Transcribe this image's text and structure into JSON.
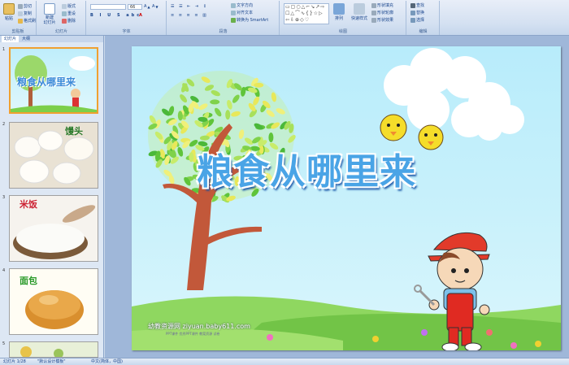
{
  "ribbon": {
    "groups": {
      "clipboard": "剪贴板",
      "slides": "幻灯片",
      "font": "字体",
      "paragraph": "段落",
      "drawing": "绘图",
      "editing": "编辑"
    },
    "paste": "粘贴",
    "cut": "剪切",
    "copy": "复制",
    "format_painter": "格式刷",
    "new_slide": "新建\n幻灯片",
    "layout": "版式",
    "reset": "重设",
    "delete": "删除",
    "font_size": "66",
    "text_direction": "文字方向",
    "align_text": "对齐文本",
    "convert_smartart": "转换为 SmartArt",
    "arrange": "排列",
    "quick_styles": "快速样式",
    "shape_fill": "形状填充",
    "shape_outline": "形状轮廓",
    "shape_effects": "形状效果",
    "find": "查找",
    "replace": "替换",
    "select": "选择"
  },
  "panel": {
    "tab_slides": "幻灯片",
    "tab_outline": "大纲",
    "thumbs": [
      {
        "num": "1",
        "caption": "粮食从哪里来"
      },
      {
        "num": "2",
        "caption": "馒头"
      },
      {
        "num": "3",
        "caption": "米饭"
      },
      {
        "num": "4",
        "caption": "面包"
      },
      {
        "num": "5",
        "caption": ""
      }
    ]
  },
  "slide": {
    "title": "粮食从哪里来",
    "credit": "幼教资源网 ziyuan.baby611.com",
    "credit_sub": "PPT课件 优秀PPT课件 教案资源 试卷"
  },
  "status": {
    "slide_counter": "幻灯片 1/28",
    "theme": "\"默认设计模板\"",
    "language": "中文(简体，中国)"
  },
  "colors": {
    "ribbon_bg": "#d3e0f1",
    "title_fill": "#4aa4e6",
    "title_shadow": "#1b57a8",
    "sky": "#b8ecfb",
    "grass": "#7ccf4a"
  }
}
